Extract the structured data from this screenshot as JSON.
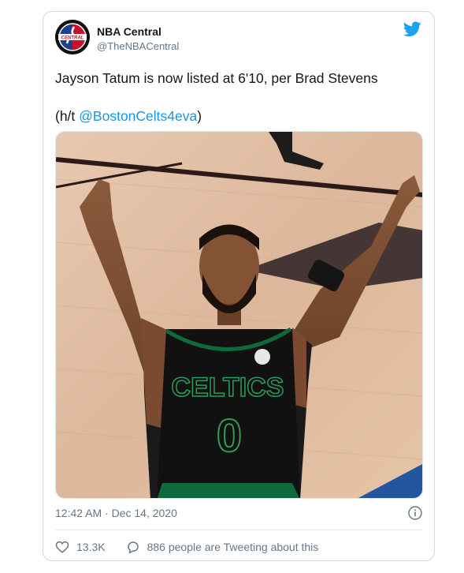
{
  "tweet": {
    "author_name": "NBA Central",
    "author_handle": "@TheNBACentral",
    "avatar_text": "CENTRAL",
    "text_line1": "Jayson Tatum is now listed at 6'10, per Brad Stevens",
    "text_prefix": "(h/t ",
    "mention": "@BostonCelts4eva",
    "text_suffix": ")",
    "timestamp": "12:42 AM · Dec 14, 2020",
    "likes": "13.3K",
    "conversation": "886 people are Tweeting about this"
  },
  "photo": {
    "jersey_text": "CELTICS",
    "jersey_number": "0"
  },
  "colors": {
    "twitter_blue": "#1da1f2",
    "link_blue": "#1b95e0",
    "secondary_text": "#657786",
    "border": "#cfd9de"
  },
  "icons": [
    "twitter-bird-icon",
    "info-icon",
    "heart-icon",
    "reply-bubble-icon"
  ]
}
